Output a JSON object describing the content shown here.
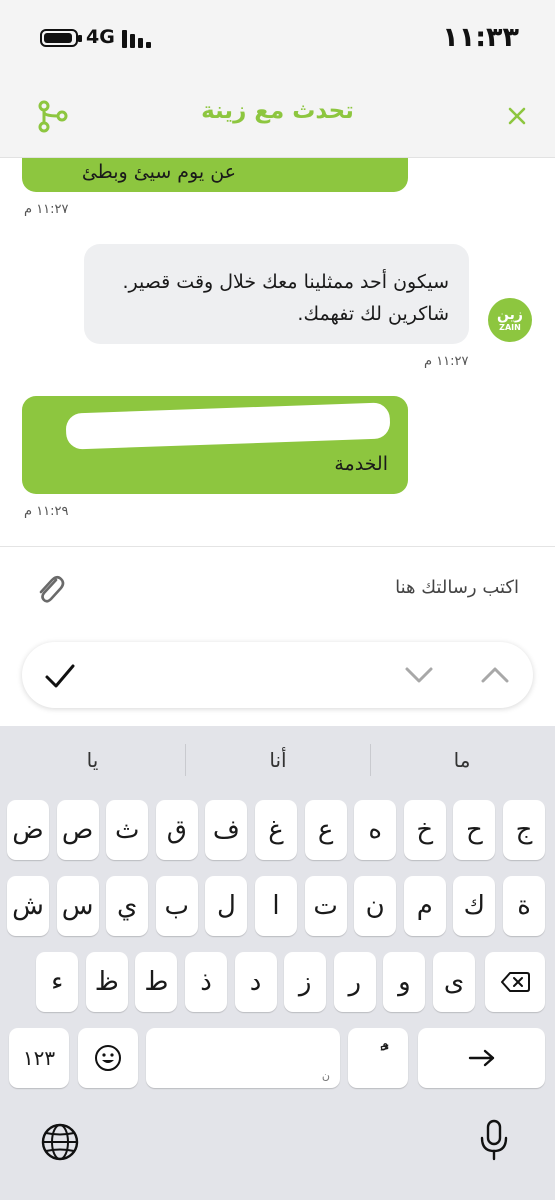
{
  "status": {
    "time": "١١:٣٣",
    "network": "4G"
  },
  "header": {
    "title": "تحدث مع زينة"
  },
  "messages": [
    {
      "sender": "user",
      "text": "عن يوم سيئ وبطئ",
      "time": "١١:٢٧ م"
    },
    {
      "sender": "agent",
      "text": "سيكون أحد ممثلينا معك خلال وقت قصير. شاكرين لك تفهمك.",
      "time": "١١:٢٧ م"
    },
    {
      "sender": "user",
      "text": "الخدمة",
      "time": "١١:٢٩ م"
    }
  ],
  "avatar": {
    "line1": "زين",
    "line2": "ZAIN"
  },
  "composer": {
    "placeholder": "اكتب رسالتك هنا"
  },
  "keyboard": {
    "suggestions": [
      "ما",
      "أنا",
      "يا"
    ],
    "row1": [
      "ج",
      "ح",
      "خ",
      "ه",
      "ع",
      "غ",
      "ف",
      "ق",
      "ث",
      "ص",
      "ض"
    ],
    "row2": [
      "ة",
      "ك",
      "م",
      "ن",
      "ت",
      "ا",
      "ل",
      "ب",
      "ي",
      "س",
      "ش"
    ],
    "row3": [
      "ى",
      "و",
      "ر",
      "ز",
      "د",
      "ذ",
      "ط",
      "ظ",
      "ء"
    ],
    "numbers_label": "١٢٣",
    "space_hint": "ن",
    "diacritic_label": "ًٌ"
  },
  "colors": {
    "brand": "#8dc63f",
    "header_bg": "#f4f4f4",
    "keyboard_bg": "#e3e4e9"
  }
}
